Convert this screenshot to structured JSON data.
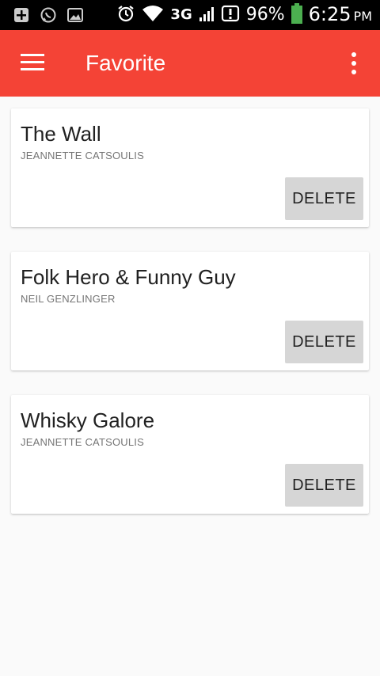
{
  "status_bar": {
    "network": "3G",
    "battery": "96%",
    "time": "6:25",
    "ampm": "PM"
  },
  "app_bar": {
    "title": "Favorite"
  },
  "favorites": [
    {
      "title": "The Wall",
      "author": "JEANNETTE CATSOULIS",
      "delete_label": "DELETE"
    },
    {
      "title": "Folk Hero & Funny Guy",
      "author": "NEIL GENZLINGER",
      "delete_label": "DELETE"
    },
    {
      "title": "Whisky Galore",
      "author": "JEANNETTE CATSOULIS",
      "delete_label": "DELETE"
    }
  ],
  "colors": {
    "app_bar": "#f44336",
    "background": "#fafafa",
    "button": "#d6d6d6"
  }
}
